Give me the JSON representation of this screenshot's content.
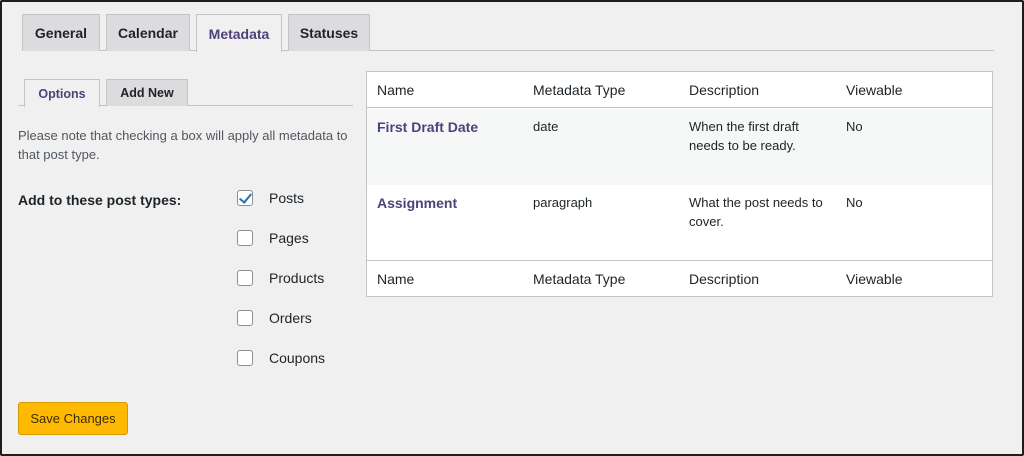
{
  "top_tabs": [
    {
      "label": "General"
    },
    {
      "label": "Calendar"
    },
    {
      "label": "Metadata"
    },
    {
      "label": "Statuses"
    }
  ],
  "sub_tabs": [
    {
      "label": "Options"
    },
    {
      "label": "Add New"
    }
  ],
  "note": "Please note that checking a box will apply all metadata to that post type.",
  "post_types": {
    "label": "Add to these post types:",
    "options": [
      {
        "label": "Posts",
        "checked": true
      },
      {
        "label": "Pages",
        "checked": false
      },
      {
        "label": "Products",
        "checked": false
      },
      {
        "label": "Orders",
        "checked": false
      },
      {
        "label": "Coupons",
        "checked": false
      }
    ]
  },
  "save_label": "Save Changes",
  "table": {
    "columns": [
      "Name",
      "Metadata Type",
      "Description",
      "Viewable"
    ],
    "rows": [
      {
        "name": "First Draft Date",
        "type": "date",
        "description": "When the first draft needs to be ready.",
        "viewable": "No"
      },
      {
        "name": "Assignment",
        "type": "paragraph",
        "description": "What the post needs to cover.",
        "viewable": "No"
      }
    ]
  },
  "colors": {
    "accent": "#50417a",
    "save_button": "#ffb900",
    "checkbox_check": "#2271b1"
  }
}
